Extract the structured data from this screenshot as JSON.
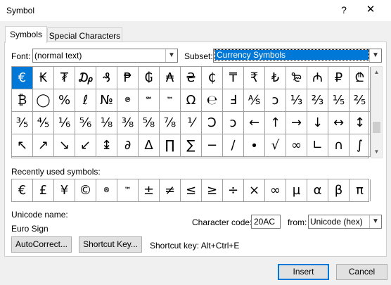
{
  "window": {
    "title": "Symbol",
    "help_glyph": "?",
    "close_glyph": "✕"
  },
  "tabs": [
    {
      "label": "Symbols",
      "key": "S",
      "active": true
    },
    {
      "label": "Special Characters",
      "key": "P",
      "active": false
    }
  ],
  "font": {
    "label": "Font:",
    "value": "(normal text)"
  },
  "subset": {
    "label": "Subset:",
    "value": "Currency Symbols"
  },
  "symbol_grid": {
    "rows": [
      [
        "€",
        "₭",
        "₮",
        "₯",
        "₰",
        "₱",
        "₲",
        "₳",
        "₴",
        "₵",
        "₸",
        "₹",
        "₺",
        "₻",
        "₼",
        "₽",
        "₾"
      ],
      [
        "₿",
        "◯",
        "%",
        "ℓ",
        "№",
        "℗",
        "℠",
        "™",
        "Ω",
        "℮",
        "Ⅎ",
        "⅍",
        "ↄ",
        "⅓",
        "⅔",
        "⅕",
        "⅖"
      ],
      [
        "⅗",
        "⅘",
        "⅙",
        "⅚",
        "⅛",
        "⅜",
        "⅝",
        "⅞",
        "⅟",
        "Ↄ",
        "ↄ",
        "←",
        "↑",
        "→",
        "↓",
        "↔",
        "↕"
      ],
      [
        "↖",
        "↗",
        "↘",
        "↙",
        "↨",
        "∂",
        "∆",
        "∏",
        "∑",
        "−",
        "∕",
        "∙",
        "√",
        "∞",
        "∟",
        "∩",
        "∫"
      ]
    ],
    "selected_index": [
      0,
      0
    ]
  },
  "recent": {
    "label": "Recently used symbols:",
    "symbols": [
      "€",
      "£",
      "¥",
      "©",
      "®",
      "™",
      "±",
      "≠",
      "≤",
      "≥",
      "÷",
      "×",
      "∞",
      "µ",
      "α",
      "β",
      "π"
    ]
  },
  "unicode_name": {
    "label": "Unicode name:",
    "value": "Euro Sign"
  },
  "char_code": {
    "label": "Character code:",
    "value": "20AC"
  },
  "from": {
    "label": "from:",
    "value": "Unicode (hex)"
  },
  "buttons": {
    "autocorrect": "AutoCorrect...",
    "shortcut_key": "Shortcut Key...",
    "insert": "Insert",
    "cancel": "Cancel"
  },
  "shortcut_text": "Shortcut key: Alt+Ctrl+E",
  "colors": {
    "accent": "#0078d7",
    "panel": "#ffffff",
    "chrome": "#f0f0f0",
    "border": "#a0a0a0"
  }
}
